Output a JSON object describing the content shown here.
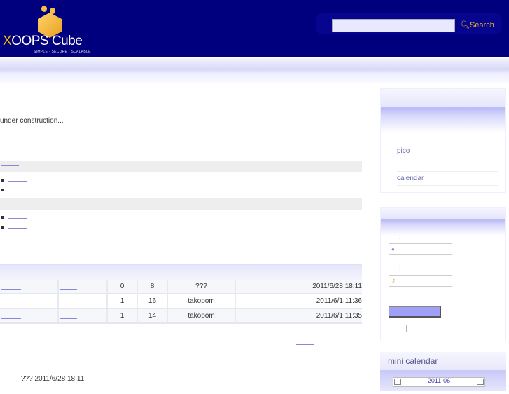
{
  "header": {
    "logo_name": "XOOPS Cube",
    "logo_name_accent": "X",
    "logo_tagline": "SIMPLE · SECURE · SCALABLE",
    "search_placeholder": "",
    "search_button": "Search"
  },
  "main": {
    "intro": "under construction...",
    "table": {
      "rows": [
        {
          "c3": "0",
          "c4": "8",
          "poster": "???",
          "date": "2011/6/28 18:11"
        },
        {
          "c3": "1",
          "c4": "16",
          "poster": "takopom",
          "date": "2011/6/1 11:36"
        },
        {
          "c3": "1",
          "c4": "14",
          "poster": "takopom",
          "date": "2011/6/1 11:35"
        }
      ]
    },
    "last_post": "??? 2011/6/28 18:11"
  },
  "sidebar": {
    "menu": [
      "pico",
      "calendar"
    ],
    "login": {
      "colon": ":",
      "separator": "|"
    },
    "minical": {
      "title": "mini calendar",
      "month": "2011-06"
    }
  },
  "colors": {
    "header": "#00007f",
    "accent": "#a0a0f8",
    "link": "#6a6ab0"
  }
}
